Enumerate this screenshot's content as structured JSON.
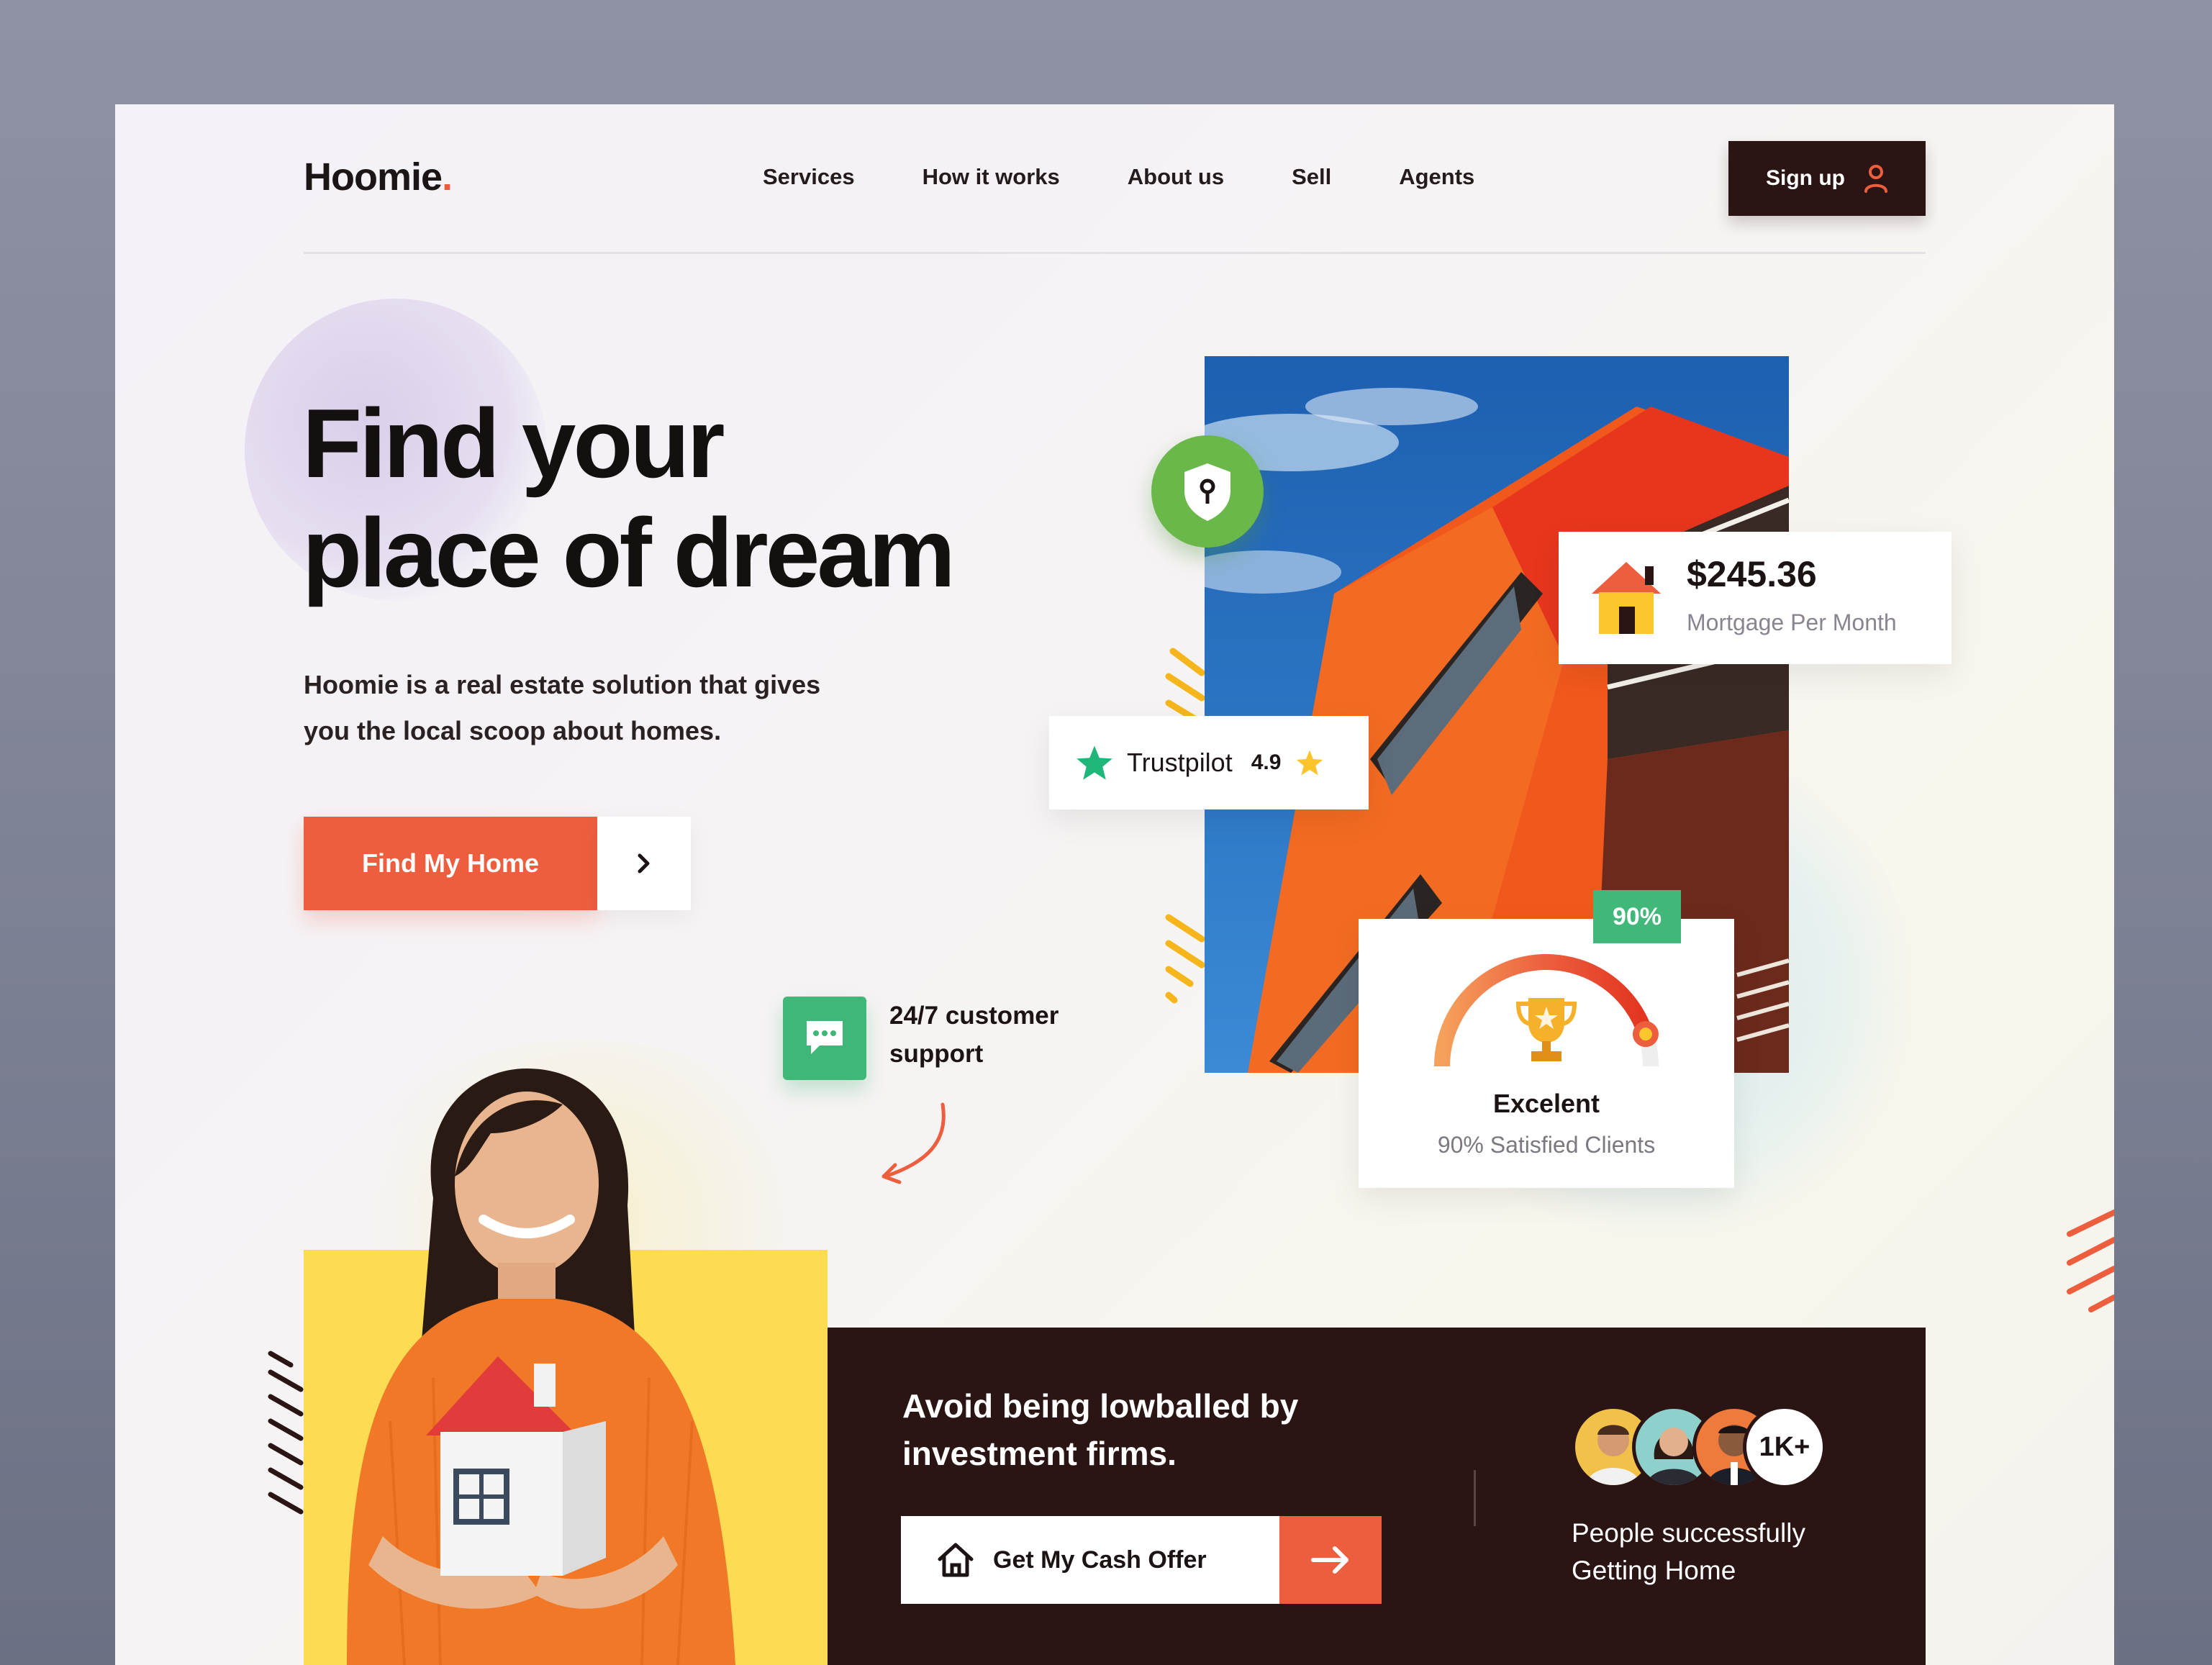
{
  "brand": {
    "name": "Hoomie",
    "dot": ".",
    "accent": "#ec5e3e",
    "dark": "#2b1414",
    "green": "#41b879"
  },
  "nav": {
    "items": [
      "Services",
      "How it works",
      "About us",
      "Sell",
      "Agents"
    ],
    "signup_label": "Sign up"
  },
  "hero": {
    "title_line1": "Find your",
    "title_line2": "place of dream",
    "subtitle_line1": "Hoomie is a real estate solution that gives",
    "subtitle_line2": "you the local scoop about homes.",
    "cta_label": "Find My Home"
  },
  "mortgage": {
    "price": "$245.36",
    "label": "Mortgage Per Month"
  },
  "trustpilot": {
    "name": "Trustpilot",
    "score": "4.9"
  },
  "rating": {
    "badge": "90%",
    "title": "Excelent",
    "subtitle": "90% Satisfied Clients",
    "level": 0.9
  },
  "support": {
    "line1": "24/7 customer",
    "line2": "support"
  },
  "cta": {
    "title_line1": "Avoid being lowballed by",
    "title_line2": "investment firms.",
    "button_label": "Get My Cash Offer"
  },
  "social_proof": {
    "count": "1K+",
    "line1": "People successfully",
    "line2": "Getting Home"
  },
  "icons": {
    "user": "user-icon",
    "chevron": "chevron-right-icon",
    "shield": "shield-key-icon",
    "house": "house-icon",
    "star": "star-icon",
    "trophy": "trophy-icon",
    "chat": "chat-icon",
    "home_outline": "home-outline-icon",
    "arrow": "arrow-right-icon"
  }
}
